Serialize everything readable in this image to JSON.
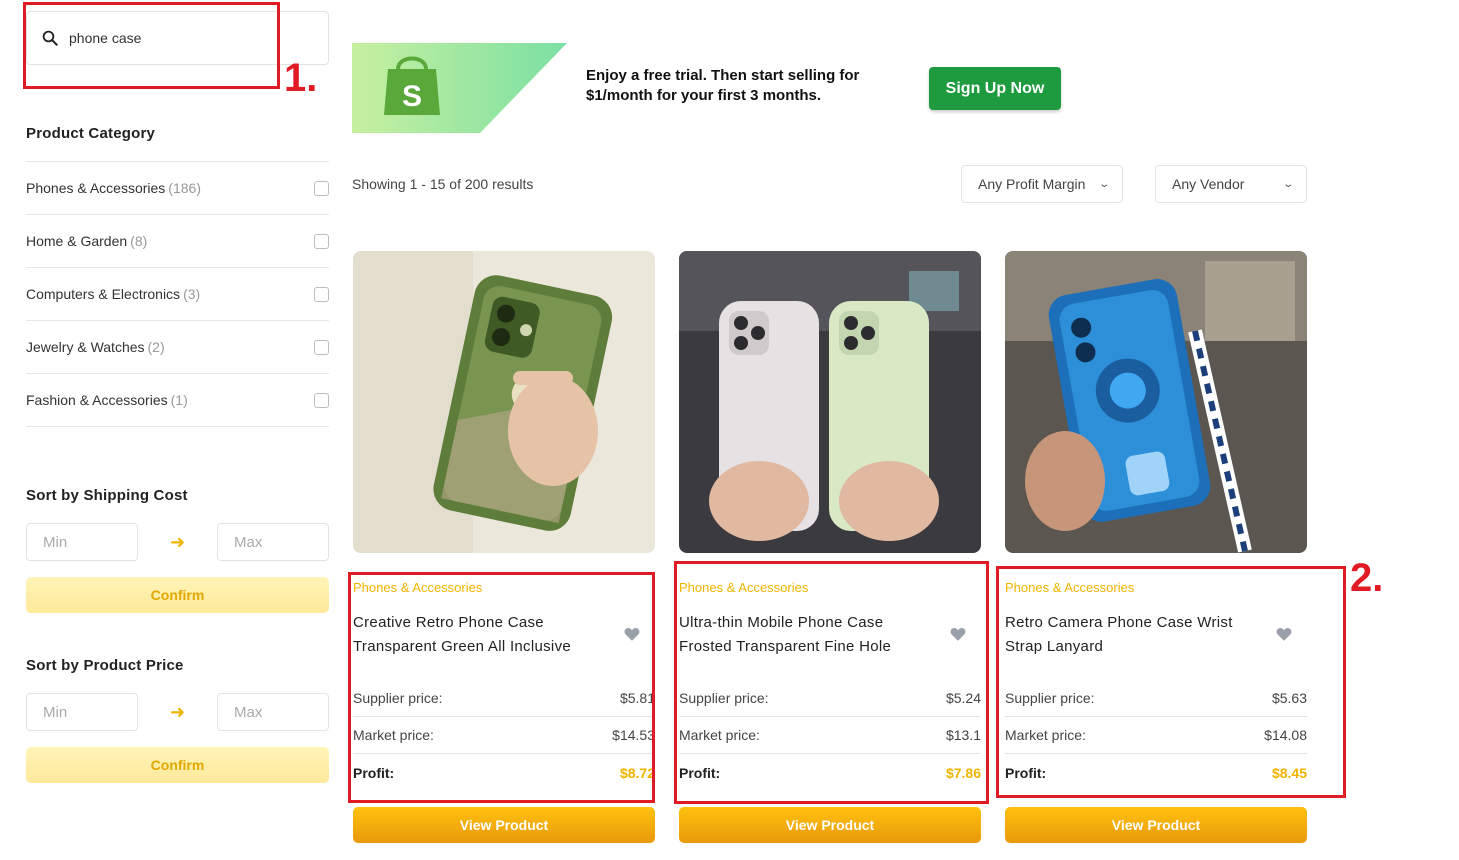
{
  "search": {
    "value": "phone case"
  },
  "annotations": {
    "one": "1.",
    "two": "2."
  },
  "sidebar": {
    "category_title": "Product Category",
    "categories": [
      {
        "name": "Phones & Accessories",
        "count": "(186)"
      },
      {
        "name": "Home & Garden",
        "count": "(8)"
      },
      {
        "name": "Computers & Electronics",
        "count": "(3)"
      },
      {
        "name": "Jewelry & Watches",
        "count": "(2)"
      },
      {
        "name": "Fashion & Accessories",
        "count": "(1)"
      }
    ],
    "shipping": {
      "title": "Sort by Shipping Cost",
      "min": "Min",
      "max": "Max",
      "confirm": "Confirm"
    },
    "price": {
      "title": "Sort by Product Price",
      "min": "Min",
      "max": "Max",
      "confirm": "Confirm"
    }
  },
  "banner": {
    "line1": "Enjoy a free trial. Then start selling for",
    "line2": "$1/month for your first 3 months.",
    "cta": "Sign Up Now"
  },
  "results": {
    "text": "Showing 1 - 15 of 200 results",
    "profit_filter": "Any Profit Margin",
    "vendor_filter": "Any Vendor"
  },
  "products": [
    {
      "category": "Phones & Accessories",
      "title": "Creative Retro Phone Case Transparent Green All Inclusive",
      "supplier_label": "Supplier price:",
      "supplier_price": "$5.81",
      "market_label": "Market price:",
      "market_price": "$14.53",
      "profit_label": "Profit:",
      "profit": "$8.72",
      "button": "View Product"
    },
    {
      "category": "Phones & Accessories",
      "title": "Ultra-thin Mobile Phone Case Frosted Transparent Fine Hole",
      "supplier_label": "Supplier price:",
      "supplier_price": "$5.24",
      "market_label": "Market price:",
      "market_price": "$13.1",
      "profit_label": "Profit:",
      "profit": "$7.86",
      "button": "View Product"
    },
    {
      "category": "Phones & Accessories",
      "title": "Retro Camera Phone Case Wrist Strap Lanyard",
      "supplier_label": "Supplier price:",
      "supplier_price": "$5.63",
      "market_label": "Market price:",
      "market_price": "$14.08",
      "profit_label": "Profit:",
      "profit": "$8.45",
      "button": "View Product"
    }
  ],
  "colors": {
    "accent": "#f0b400",
    "annotation": "#e01b24",
    "signup": "#1e9b3e"
  }
}
